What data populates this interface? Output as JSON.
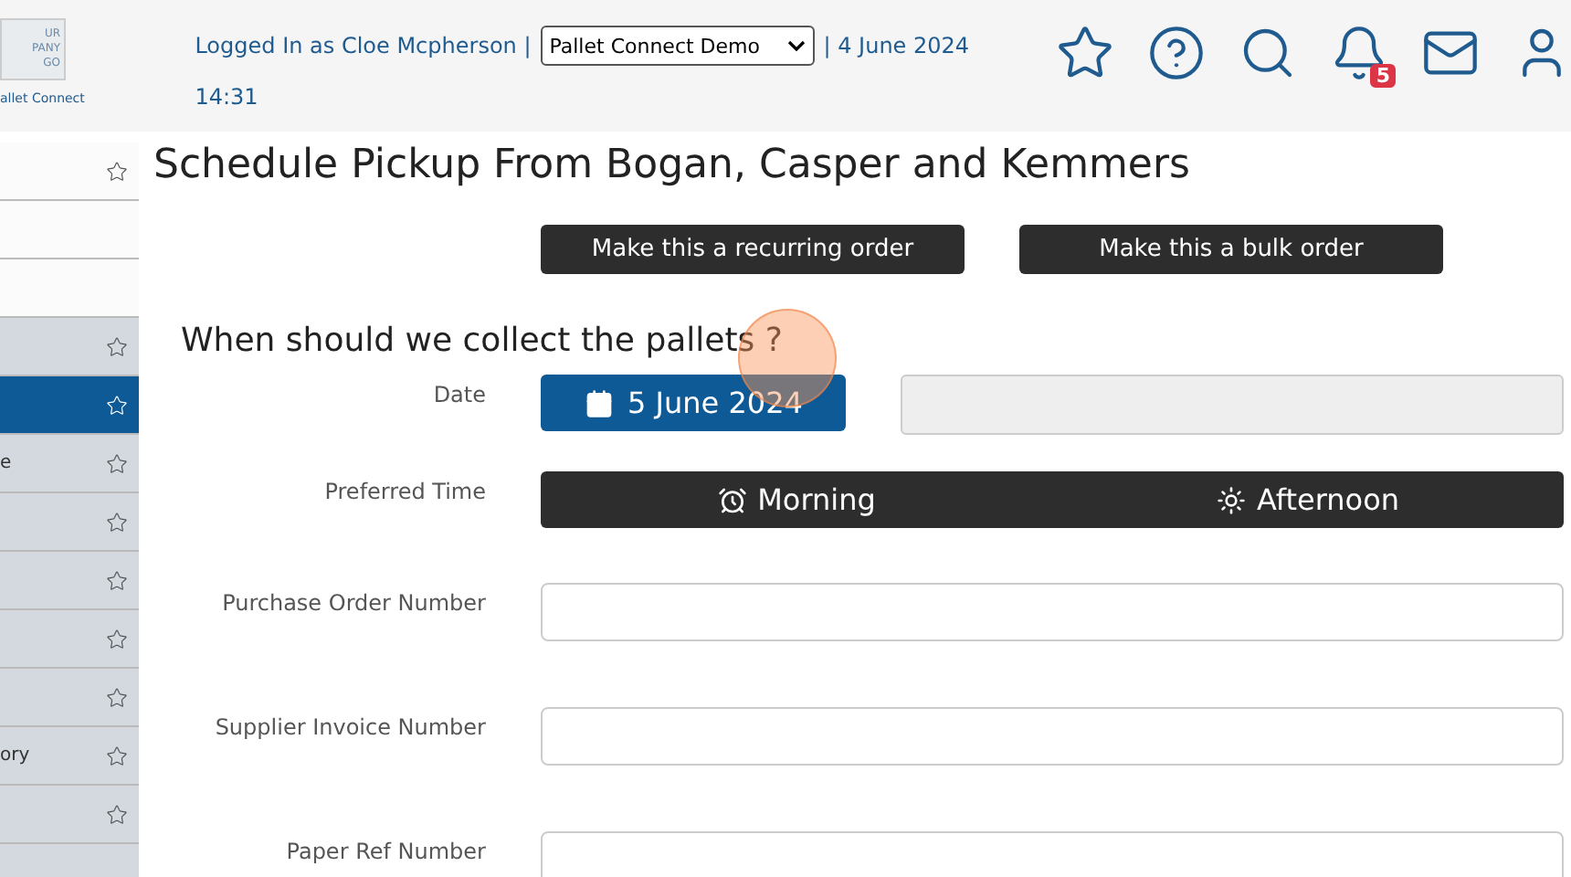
{
  "logo": {
    "lines": [
      "UR",
      "PANY",
      "GO"
    ],
    "caption": "allet Connect"
  },
  "header": {
    "logged_in": "Logged In as Cloe Mcpherson |",
    "account_select": "Pallet Connect Demo",
    "date": "| 4 June 2024",
    "time": "14:31",
    "notification_count": "5"
  },
  "sidebar": {
    "items": [
      {
        "starred": true,
        "selected": false,
        "shaded": false
      },
      {
        "starred": false,
        "selected": false,
        "shaded": false
      },
      {
        "starred": false,
        "selected": false,
        "shaded": false
      },
      {
        "starred": true,
        "selected": false,
        "shaded": true
      },
      {
        "starred": true,
        "selected": true,
        "shaded": true
      },
      {
        "label": "e",
        "starred": true,
        "selected": false,
        "shaded": true
      },
      {
        "starred": true,
        "selected": false,
        "shaded": true
      },
      {
        "starred": true,
        "selected": false,
        "shaded": true
      },
      {
        "starred": true,
        "selected": false,
        "shaded": true
      },
      {
        "starred": true,
        "selected": false,
        "shaded": true
      },
      {
        "label": "ory",
        "starred": true,
        "selected": false,
        "shaded": true
      },
      {
        "starred": true,
        "selected": false,
        "shaded": true
      },
      {
        "starred": false,
        "selected": false,
        "shaded": true
      }
    ]
  },
  "page_title": "Schedule Pickup From Bogan, Casper and Kemmers",
  "order_buttons": [
    "Make this a recurring order",
    "Make this a bulk order"
  ],
  "section_title": "When should we collect the pallets ?",
  "form": [
    {
      "kind": "date",
      "label": "Date",
      "value": "5 June 2024"
    },
    {
      "kind": "time",
      "label": "Preferred Time",
      "options": [
        "Morning",
        "Afternoon"
      ]
    },
    {
      "kind": "text",
      "label": "Purchase Order Number"
    },
    {
      "kind": "text",
      "label": "Supplier Invoice Number"
    },
    {
      "kind": "text",
      "label": "Paper Ref Number"
    }
  ]
}
